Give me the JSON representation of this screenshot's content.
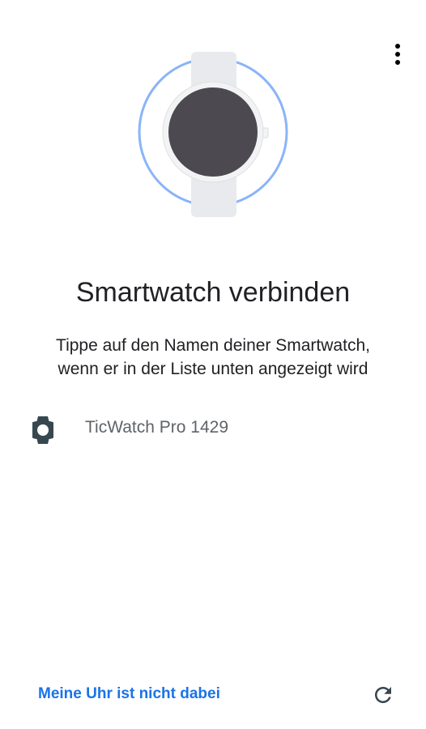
{
  "header": {
    "overflow_menu_icon": "more-vert-icon"
  },
  "hero": {
    "illustration": "smartwatch-illustration",
    "ring_color": "#8ab4f8",
    "band_color": "#e8eaed",
    "case_color": "#f1f3f4",
    "face_color": "#4d4950"
  },
  "main": {
    "title": "Smartwatch verbinden",
    "subtitle_line1": "Tippe auf den Namen deiner Smartwatch,",
    "subtitle_line2": "wenn er in der Liste unten angezeigt wird"
  },
  "devices": [
    {
      "icon": "watch-icon",
      "name": "TicWatch Pro 1429"
    }
  ],
  "footer": {
    "link_label": "Meine Uhr ist nicht dabei",
    "refresh_icon": "refresh-icon"
  },
  "colors": {
    "accent": "#1a73e8",
    "text_primary": "#202124",
    "text_secondary": "#5f6368",
    "icon": "#37474f"
  }
}
